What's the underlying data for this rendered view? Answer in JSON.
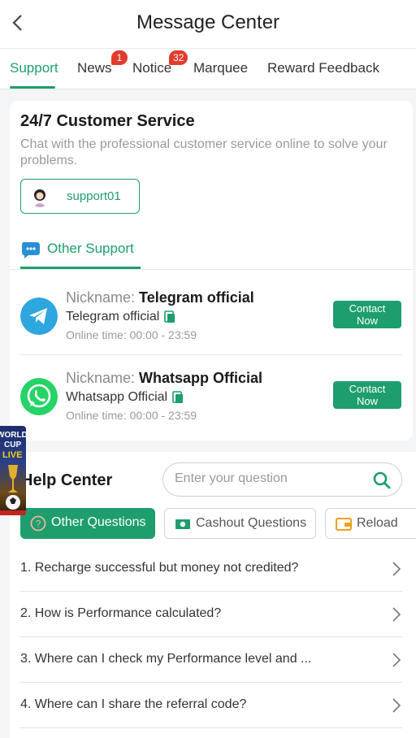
{
  "header": {
    "title": "Message Center"
  },
  "tabs": [
    {
      "label": "Support",
      "active": true
    },
    {
      "label": "News",
      "badge": "1"
    },
    {
      "label": "Notice",
      "badge": "32"
    },
    {
      "label": "Marquee"
    },
    {
      "label": "Reward Feedback"
    }
  ],
  "customer_service": {
    "title": "24/7 Customer Service",
    "description": "Chat with the professional customer service online to solve your problems.",
    "support_button": "support01"
  },
  "other_support": {
    "tab_label": "Other Support",
    "contacts": [
      {
        "nickname_key": "Nickname: ",
        "nickname": "Telegram official",
        "handle": "Telegram official",
        "online_time": "Online time: 00:00 - 23:59",
        "button": "Contact Now",
        "icon": "telegram-icon",
        "color": "#2ea6df"
      },
      {
        "nickname_key": "Nickname: ",
        "nickname": "Whatsapp Official",
        "handle": "Whatsapp Official",
        "online_time": "Online time: 00:00 - 23:59",
        "button": "Contact Now",
        "icon": "whatsapp-icon",
        "color": "#25d366"
      }
    ]
  },
  "help_center": {
    "title": "Help Center",
    "search_placeholder": "Enter your question",
    "categories": [
      {
        "label": "Other Questions",
        "active": true,
        "icon": "question-icon"
      },
      {
        "label": "Cashout Questions",
        "icon": "cash-icon"
      },
      {
        "label": "Reload",
        "icon": "wallet-icon"
      }
    ],
    "faqs": [
      "1. Recharge successful but money not credited?",
      "2. How is Performance calculated?",
      "3. Where can I check my Performance level and ...",
      "4. Where can I share the referral code?"
    ]
  },
  "floating_banner": {
    "lines": [
      "WORLD",
      "CUP",
      "LIVE"
    ]
  },
  "colors": {
    "accent": "#1e9e6d",
    "badge": "#e23b2e"
  }
}
